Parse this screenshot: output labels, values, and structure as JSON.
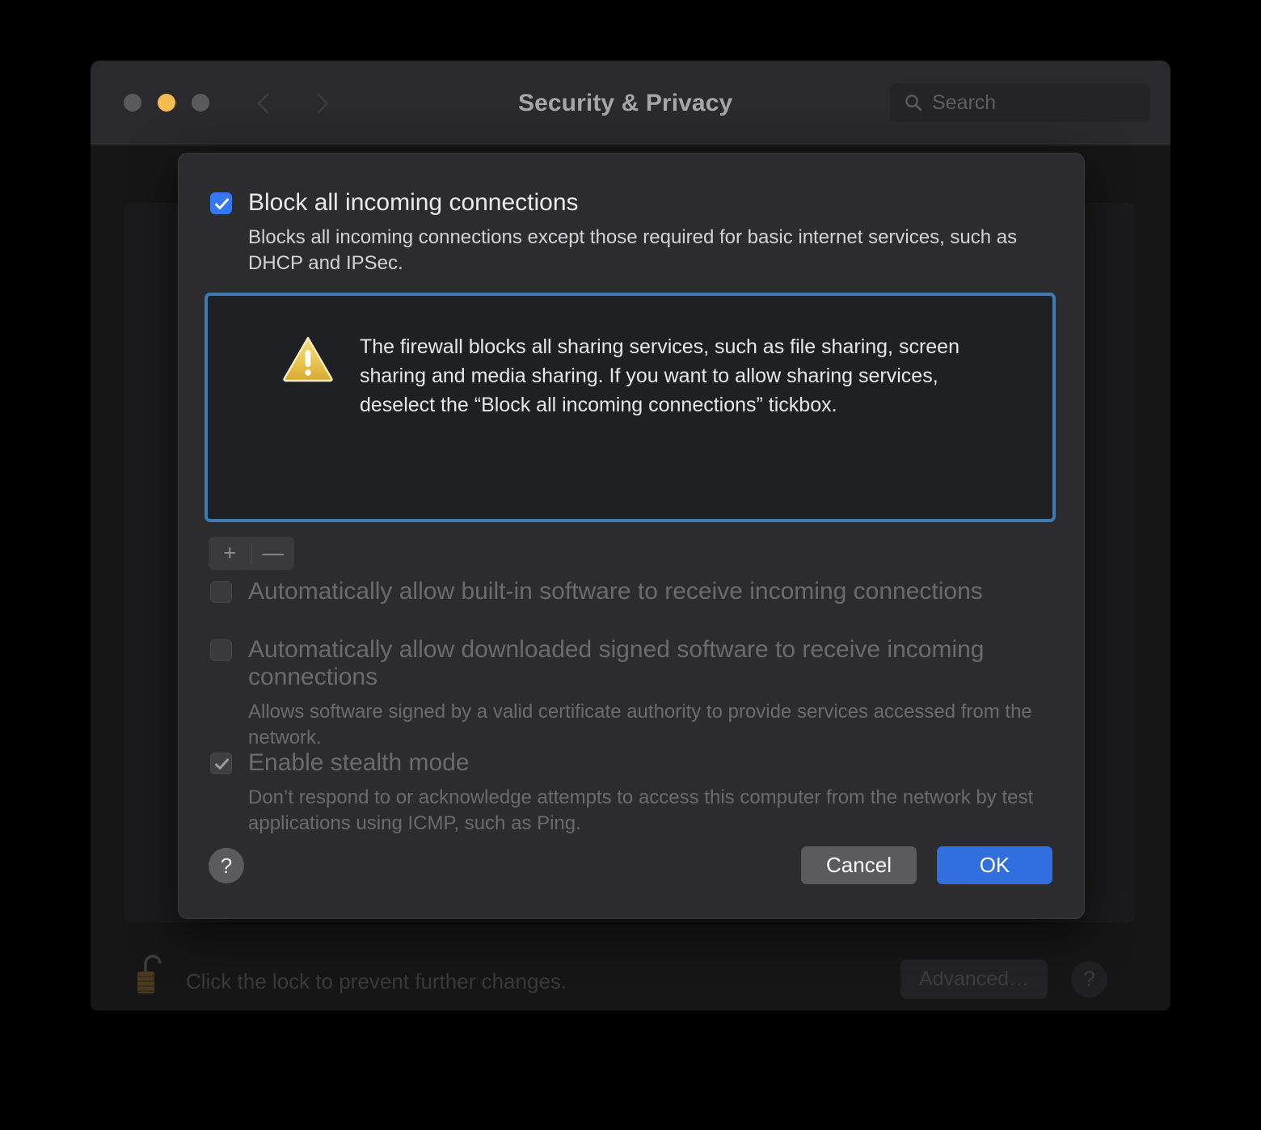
{
  "window": {
    "title": "Security & Privacy",
    "traffic_lights": [
      "close",
      "minimize",
      "zoom"
    ],
    "nav": {
      "back": "back-arrow",
      "forward": "forward-arrow"
    },
    "grid_icon": "show-all-grid-icon",
    "search": {
      "placeholder": "Search",
      "value": ""
    }
  },
  "background": {
    "lock_caption": "Click the lock to prevent further changes.",
    "lock_icon": "unlocked-padlock-icon",
    "advanced_button": "Advanced…",
    "help_button": "?"
  },
  "sheet": {
    "block_all": {
      "label": "Block all incoming connections",
      "checked": true,
      "description": "Blocks all incoming connections except those required for basic internet services, such as DHCP and IPSec."
    },
    "warning": {
      "icon": "caution-triangle-icon",
      "text": "The firewall blocks all sharing services, such as file sharing, screen sharing and media sharing. If you want to allow sharing services, deselect the “Block all incoming connections” tickbox."
    },
    "segmented": {
      "add": "+",
      "remove": "—"
    },
    "auto_builtin": {
      "label": "Automatically allow built-in software to receive incoming connections",
      "checked": false
    },
    "auto_signed": {
      "label": "Automatically allow downloaded signed software to receive incoming connections",
      "checked": false,
      "description": "Allows software signed by a valid certificate authority to provide services accessed from the network."
    },
    "stealth": {
      "label": "Enable stealth mode",
      "checked": true,
      "description": "Don’t respond to or acknowledge attempts to access this computer from the network by test applications using ICMP, such as Ping."
    },
    "footer": {
      "help": "?",
      "cancel": "Cancel",
      "ok": "OK"
    }
  },
  "colors": {
    "accent_blue": "#3478f6",
    "ok_blue": "#2f6fe0",
    "focus_ring": "#3f7ab0",
    "warning_yellow": "#e8b63c",
    "minimize_yellow": "#f5bd4f",
    "sheet_bg": "#2c2c2e",
    "window_bg": "#161616"
  }
}
